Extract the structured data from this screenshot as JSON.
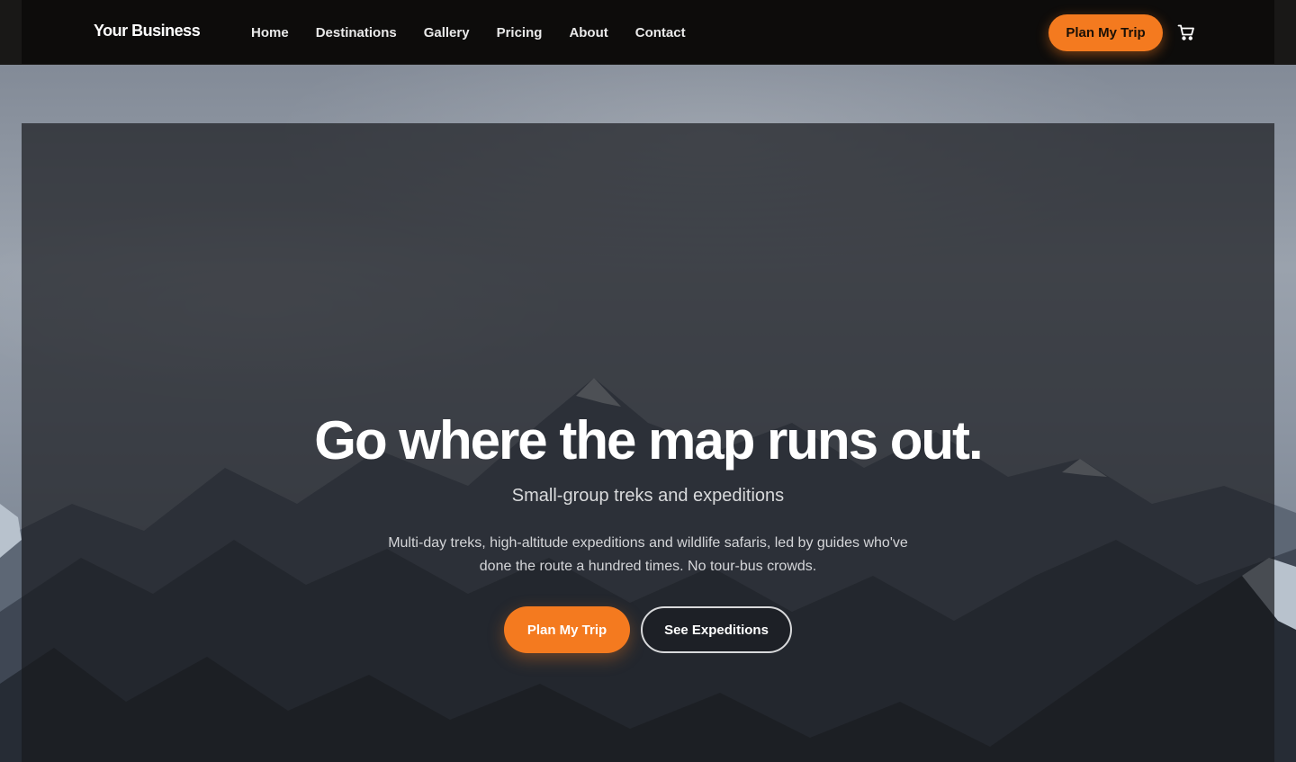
{
  "brand": {
    "name": "Your Business"
  },
  "nav": {
    "links": [
      "Home",
      "Destinations",
      "Gallery",
      "Pricing",
      "About",
      "Contact"
    ],
    "cta_label": "Plan My Trip",
    "cart_icon": "cart-icon"
  },
  "hero": {
    "title": "Go where the map runs out.",
    "subtitle": "Small-group treks and expeditions",
    "description": "Multi-day treks, high-altitude expeditions and wildlife safaris, led by guides who've done the route a hundred times. No tour-bus crowds.",
    "primary_button": "Plan My Trip",
    "secondary_button": "See Expeditions"
  },
  "colors": {
    "accent": "#f47a1f",
    "nav_background": "#0d0c0b",
    "overlay": "#181a1e"
  }
}
